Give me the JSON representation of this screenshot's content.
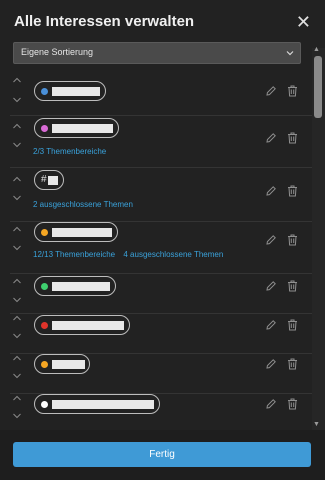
{
  "dialog": {
    "title": "Alle Interessen verwalten",
    "close_label": "✕"
  },
  "sort": {
    "selected": "Eigene Sortierung",
    "icon": "chevron-down-icon"
  },
  "colors": {
    "accent": "#3f9ad6",
    "link": "#3aa2db",
    "dot_blue": "#4a90d9",
    "dot_pink": "#d96bd6",
    "dot_orange": "#f5a623",
    "dot_green": "#3ecf6e",
    "dot_red": "#e0342b",
    "dot_white": "#ffffff"
  },
  "interests": [
    {
      "dot_color": "#4a90d9",
      "name_redacted": true,
      "subtitles": []
    },
    {
      "dot_color": "#d96bd6",
      "name_redacted": true,
      "subtitles": [
        "2/3 Themenbereiche"
      ]
    },
    {
      "hashtag": "#",
      "name_redacted": true,
      "subtitles": [
        "2 ausgeschlossene Themen"
      ]
    },
    {
      "dot_color": "#f5a623",
      "name_redacted": true,
      "subtitles": [
        "12/13 Themenbereiche",
        "4 ausgeschlossene Themen"
      ]
    },
    {
      "dot_color": "#3ecf6e",
      "name_redacted": true,
      "subtitles": []
    },
    {
      "dot_color": "#e0342b",
      "name_redacted": true,
      "subtitles": []
    },
    {
      "dot_color": "#f5a623",
      "name_redacted": true,
      "subtitles": []
    },
    {
      "dot_color": "#ffffff",
      "name_redacted": true,
      "subtitles": []
    }
  ],
  "footer": {
    "done_label": "Fertig"
  }
}
